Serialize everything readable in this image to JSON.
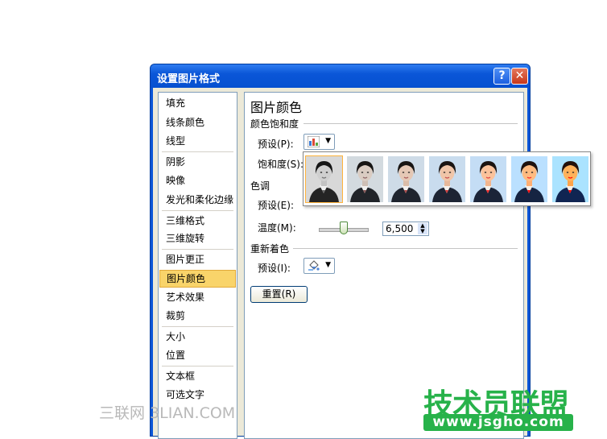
{
  "dialog": {
    "title": "设置图片格式",
    "help_label": "?",
    "close_label": "✕"
  },
  "nav": {
    "items": [
      {
        "label": "填充"
      },
      {
        "label": "线条颜色"
      },
      {
        "label": "线型"
      },
      {
        "label": "阴影"
      },
      {
        "label": "映像"
      },
      {
        "label": "发光和柔化边缘"
      },
      {
        "label": "三维格式"
      },
      {
        "label": "三维旋转"
      },
      {
        "label": "图片更正"
      },
      {
        "label": "图片颜色",
        "selected": true
      },
      {
        "label": "艺术效果"
      },
      {
        "label": "裁剪"
      },
      {
        "label": "大小"
      },
      {
        "label": "位置"
      },
      {
        "label": "文本框"
      },
      {
        "label": "可选文字"
      }
    ]
  },
  "panel": {
    "title": "图片颜色",
    "saturation": {
      "heading": "颜色饱和度",
      "preset_label": "预设(P):",
      "saturation_label": "饱和度(S):"
    },
    "tone": {
      "heading": "色调",
      "preset_label": "预设(E):",
      "temperature_label": "温度(M):",
      "temperature_value": "6,500"
    },
    "recolor": {
      "heading": "重新着色",
      "preset_label": "预设(I):"
    },
    "reset_label": "重置(R)"
  },
  "gallery": {
    "thumbnail_count": 7,
    "selected_index": 0,
    "saturation_levels": [
      0,
      0.33,
      0.66,
      1,
      1.33,
      2,
      3
    ]
  },
  "watermarks": {
    "left": "三联网 3LIAN.COM",
    "right_top": "技术员联盟",
    "right_bottom": "www.jsgho.com"
  },
  "colors": {
    "title_bar": "#0a56d8",
    "selected_nav": "#f9d46a",
    "watermark_green": "#27b24a"
  }
}
